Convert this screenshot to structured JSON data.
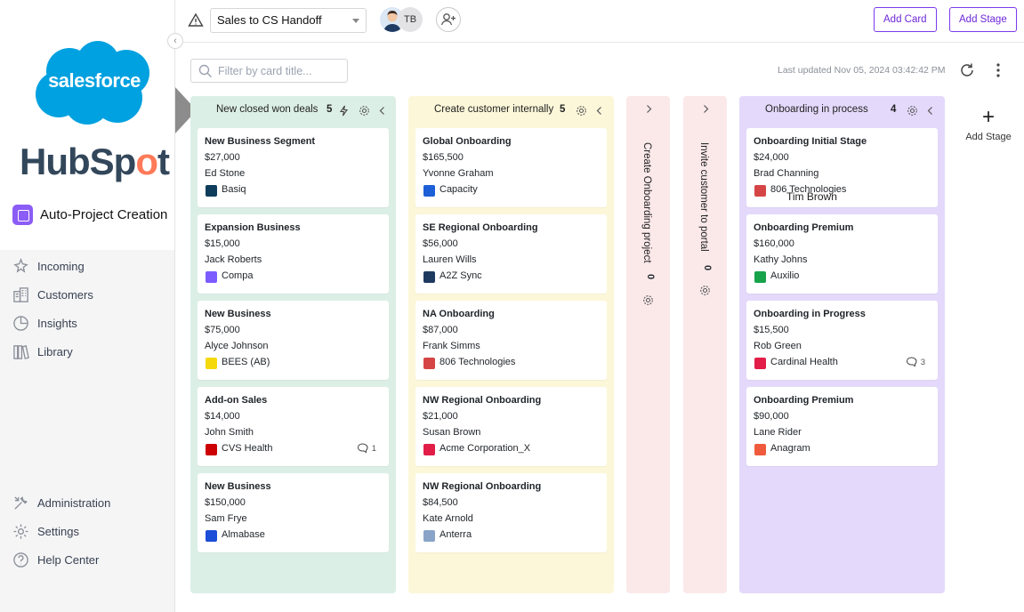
{
  "sidebar": {
    "brand_salesforce": "salesforce",
    "brand_hubspot_pre": "HubSp",
    "brand_hubspot_o": "o",
    "brand_hubspot_post": "t",
    "app_name": "Auto-Project Creation",
    "nav_main": [
      {
        "label": "Incoming",
        "icon": "incoming-icon"
      },
      {
        "label": "Customers",
        "icon": "customers-icon"
      },
      {
        "label": "Insights",
        "icon": "insights-icon"
      },
      {
        "label": "Library",
        "icon": "library-icon"
      }
    ],
    "nav_bottom": [
      {
        "label": "Administration",
        "icon": "administration-icon"
      },
      {
        "label": "Settings",
        "icon": "settings-icon"
      },
      {
        "label": "Help Center",
        "icon": "help-icon"
      }
    ]
  },
  "topbar": {
    "board_name": "Sales to CS Handoff",
    "avatar_initials": "TB",
    "add_card_label": "Add Card",
    "add_stage_label": "Add Stage"
  },
  "toolbar": {
    "filter_placeholder": "Filter by card title...",
    "last_updated": "Last updated Nov 05, 2024 03:42:42 PM"
  },
  "columns": [
    {
      "title": "New closed won deals",
      "count": "5",
      "bg": "#dcefe6",
      "cards": [
        {
          "title": "New Business Segment",
          "amount": "$27,000",
          "owner": "Ed Stone",
          "company": "Basiq",
          "logo_color": "#0f3d5c"
        },
        {
          "title": "Expansion Business",
          "amount": "$15,000",
          "owner": "Jack Roberts",
          "company": "Compa",
          "logo_color": "#7c5cff"
        },
        {
          "title": "New Business",
          "amount": "$75,000",
          "owner": "Alyce Johnson",
          "company": "BEES (AB)",
          "logo_color": "#f5d90a"
        },
        {
          "title": "Add-on Sales",
          "amount": "$14,000",
          "owner": "John Smith",
          "company": "CVS Health",
          "logo_color": "#cc0000",
          "comments": "1"
        },
        {
          "title": "New Business",
          "amount": "$150,000",
          "owner": "Sam Frye",
          "company": "Almabase",
          "logo_color": "#1d4ed8"
        }
      ]
    },
    {
      "title": "Create customer internally",
      "count": "5",
      "bg": "#fcf7d9",
      "cards": [
        {
          "title": "Global Onboarding",
          "amount": "$165,500",
          "owner": "Yvonne Graham",
          "company": "Capacity",
          "logo_color": "#1d5fd6"
        },
        {
          "title": "SE Regional Onboarding",
          "amount": "$56,000",
          "owner": "Lauren Wills",
          "company": "A2Z Sync",
          "logo_color": "#1e3a5f"
        },
        {
          "title": "NA Onboarding",
          "amount": "$87,000",
          "owner": "Frank Simms",
          "company": "806 Technologies",
          "logo_color": "#d64545"
        },
        {
          "title": "NW Regional Onboarding",
          "amount": "$21,000",
          "owner": "Susan Brown",
          "company": "Acme Corporation_X",
          "logo_color": "#e11d48"
        },
        {
          "title": "NW Regional Onboarding",
          "amount": "$84,500",
          "owner": "Kate Arnold",
          "company": "Anterra",
          "logo_color": "#8aa4c8"
        }
      ]
    },
    {
      "title": "Create Onboarding project",
      "count": "0",
      "bg": "#fbe9ea"
    },
    {
      "title": "Invite customer to portal",
      "count": "0",
      "bg": "#fbe9ea"
    },
    {
      "title": "Onboarding in process",
      "count": "4",
      "bg": "#e4d9fb",
      "cards": [
        {
          "title": "Onboarding Initial Stage",
          "amount": "$24,000",
          "owner": "Brad Channing",
          "company": "806 Technologies",
          "logo_color": "#d64545"
        },
        {
          "title": "Onboarding Premium",
          "amount": "$160,000",
          "owner": "Kathy Johns",
          "company": "Auxilio",
          "logo_color": "#16a34a"
        },
        {
          "title": "Onboarding in Progress",
          "amount": "$15,500",
          "owner": "Rob Green",
          "company": "Cardinal Health",
          "logo_color": "#e11d48",
          "comments": "3"
        },
        {
          "title": "Onboarding Premium",
          "amount": "$90,000",
          "owner": "Lane Rider",
          "company": "Anagram",
          "logo_color": "#f05a3c"
        }
      ]
    }
  ],
  "add_stage_col_label": "Add Stage",
  "overlay_name": "Tim Brown"
}
